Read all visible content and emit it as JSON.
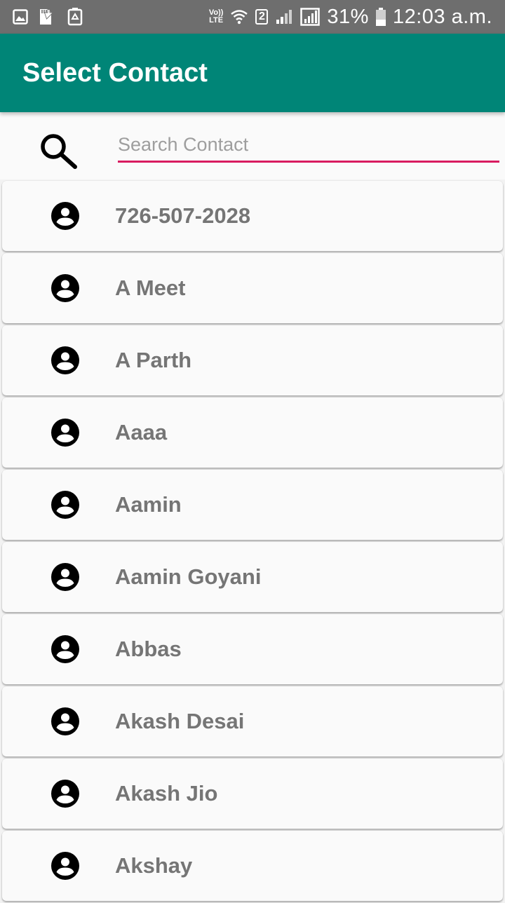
{
  "status_bar": {
    "volte_top": "Vo))",
    "volte_bottom": "LTE",
    "sim_number": "2",
    "battery_percent": "31%",
    "time": "12:03 a.m."
  },
  "app_bar": {
    "title": "Select Contact",
    "color": "#008577"
  },
  "search": {
    "placeholder": "Search Contact",
    "value": "",
    "underline_color": "#d81b60"
  },
  "contacts": [
    {
      "name": "726-507-2028",
      "icon": "account-circle-icon"
    },
    {
      "name": "A Meet",
      "icon": "account-circle-icon"
    },
    {
      "name": "A Parth",
      "icon": "account-circle-icon"
    },
    {
      "name": "Aaaa",
      "icon": "account-circle-icon"
    },
    {
      "name": "Aamin",
      "icon": "account-circle-icon"
    },
    {
      "name": "Aamin Goyani",
      "icon": "account-circle-icon"
    },
    {
      "name": "Abbas",
      "icon": "account-circle-icon"
    },
    {
      "name": "Akash Desai",
      "icon": "account-circle-icon"
    },
    {
      "name": "Akash Jio",
      "icon": "account-circle-icon"
    },
    {
      "name": "Akshay",
      "icon": "account-circle-icon"
    }
  ]
}
